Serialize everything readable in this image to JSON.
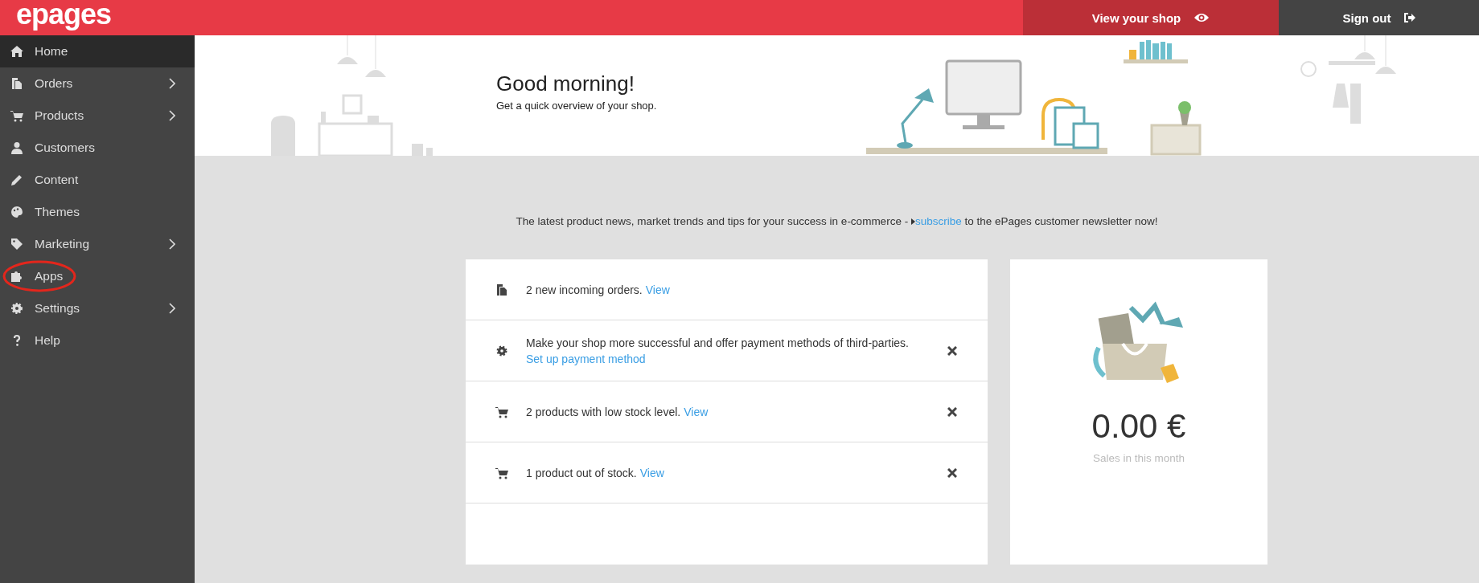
{
  "header": {
    "logo": "epages",
    "view_shop": "View your shop",
    "sign_out": "Sign out"
  },
  "sidebar": {
    "items": [
      {
        "label": "Home",
        "selected": true,
        "has_submenu": false,
        "circled": false
      },
      {
        "label": "Orders",
        "selected": false,
        "has_submenu": true,
        "circled": false
      },
      {
        "label": "Products",
        "selected": false,
        "has_submenu": true,
        "circled": false
      },
      {
        "label": "Customers",
        "selected": false,
        "has_submenu": false,
        "circled": false
      },
      {
        "label": "Content",
        "selected": false,
        "has_submenu": false,
        "circled": false
      },
      {
        "label": "Themes",
        "selected": false,
        "has_submenu": false,
        "circled": false
      },
      {
        "label": "Marketing",
        "selected": false,
        "has_submenu": true,
        "circled": false
      },
      {
        "label": "Apps",
        "selected": false,
        "has_submenu": false,
        "circled": true
      },
      {
        "label": "Settings",
        "selected": false,
        "has_submenu": true,
        "circled": false
      },
      {
        "label": "Help",
        "selected": false,
        "has_submenu": false,
        "circled": false
      }
    ]
  },
  "banner": {
    "title": "Good morning!",
    "subtitle": "Get a quick overview of your shop."
  },
  "newsletter": {
    "before": "The latest product news, market trends and tips for your success in e-commerce -",
    "link": "subscribe",
    "after": "to the ePages customer newsletter now!"
  },
  "tasks": [
    {
      "text": "2 new incoming orders.",
      "link": "View",
      "link_below": false,
      "dismissible": false
    },
    {
      "text": "Make your shop more successful and offer payment methods of third-parties.",
      "link": "Set up payment method",
      "link_below": true,
      "dismissible": true
    },
    {
      "text": "2 products with low stock level.",
      "link": "View",
      "link_below": false,
      "dismissible": true
    },
    {
      "text": "1 product out of stock.",
      "link": "View",
      "link_below": false,
      "dismissible": true
    }
  ],
  "sales": {
    "amount": "0.00 €",
    "caption": "Sales in this month"
  }
}
